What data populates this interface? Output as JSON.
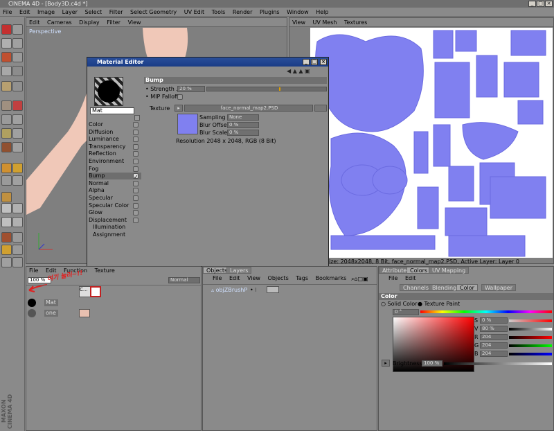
{
  "window": {
    "title": "CINEMA 4D - [Body3D.c4d *]",
    "buttons": [
      "_",
      "□",
      "×"
    ]
  },
  "menu": [
    "File",
    "Edit",
    "Image",
    "Layer",
    "Select",
    "Filter",
    "Select Geometry",
    "UV Edit",
    "Tools",
    "Render",
    "Plugins",
    "Window",
    "Help"
  ],
  "viewport_left": {
    "menu": [
      "Edit",
      "Cameras",
      "Display",
      "Filter",
      "View"
    ],
    "label": "Perspective"
  },
  "viewport_right": {
    "menu": [
      "View",
      "UV Mesh",
      "Textures"
    ],
    "status": "ize: 2048x2048, 8 Bit, face_normal_map2.PSD, Active Layer: Layer 0"
  },
  "material_editor": {
    "title": "Material Editor",
    "material_name": "Mat",
    "channels": [
      {
        "label": "Color",
        "checked": false
      },
      {
        "label": "Diffusion",
        "checked": false
      },
      {
        "label": "Luminance",
        "checked": false
      },
      {
        "label": "Transparency",
        "checked": false
      },
      {
        "label": "Reflection",
        "checked": false
      },
      {
        "label": "Environment",
        "checked": false
      },
      {
        "label": "Fog",
        "checked": false
      },
      {
        "label": "Bump",
        "checked": true
      },
      {
        "label": "Normal",
        "checked": false
      },
      {
        "label": "Alpha",
        "checked": false
      },
      {
        "label": "Specular",
        "checked": false
      },
      {
        "label": "Specular Color",
        "checked": false
      },
      {
        "label": "Glow",
        "checked": false
      },
      {
        "label": "Displacement",
        "checked": false
      },
      {
        "label": "Illumination",
        "checked": null
      },
      {
        "label": "Assignment",
        "checked": null
      }
    ],
    "section": "Bump",
    "strength_label": "Strength",
    "strength_value": "20 %",
    "mip_label": "MIP Falloff",
    "texture_label": "Texture",
    "texture_file": "face_normal_map2.PSD",
    "sampling_label": "Sampling",
    "sampling_value": "None",
    "blur_offset_label": "Blur Offset",
    "blur_offset_value": "0 %",
    "blur_scale_label": "Blur Scale",
    "blur_scale_value": "0 %",
    "resolution": "Resolution 2048 x 2048, RGB (8 Bit)"
  },
  "material_manager": {
    "menu": [
      "File",
      "Edit",
      "Function",
      "Texture"
    ],
    "percent": "100 %",
    "blend": "Normal",
    "annotation": "여기 눌러~!!",
    "rows": [
      {
        "name": "Mat"
      },
      {
        "name": "one"
      }
    ],
    "col_c": "C..."
  },
  "object_manager": {
    "tabs": [
      "Objects",
      "Layers"
    ],
    "menu": [
      "File",
      "Edit",
      "View",
      "Objects",
      "Tags",
      "Bookmarks"
    ],
    "object_name": "objZBrushP"
  },
  "attributes": {
    "tabs": [
      "Attributes",
      "Colors",
      "UV Mapping"
    ],
    "menu": [
      "File",
      "Edit"
    ],
    "subtabs": [
      "Channels",
      "Blending",
      "Color",
      "Wallpaper"
    ],
    "section": "Color",
    "solid_color": "Solid Color",
    "texture_paint": "Texture Paint",
    "hue_value": "0 °",
    "s_label": "S",
    "s_value": "0 %",
    "v_label": "V",
    "v_value": "80 %",
    "r_label": "R",
    "r_value": "204",
    "g_label": "G",
    "g_value": "204",
    "b_label": "B",
    "b_value": "204",
    "brightness_label": "Brightness",
    "brightness_value": "100 %"
  },
  "brand": "MAXON CINEMA 4D",
  "colors": {
    "uv_fill": "#8080f0",
    "dialog_title": "#1a3c86",
    "annotation_red": "#e02020"
  }
}
